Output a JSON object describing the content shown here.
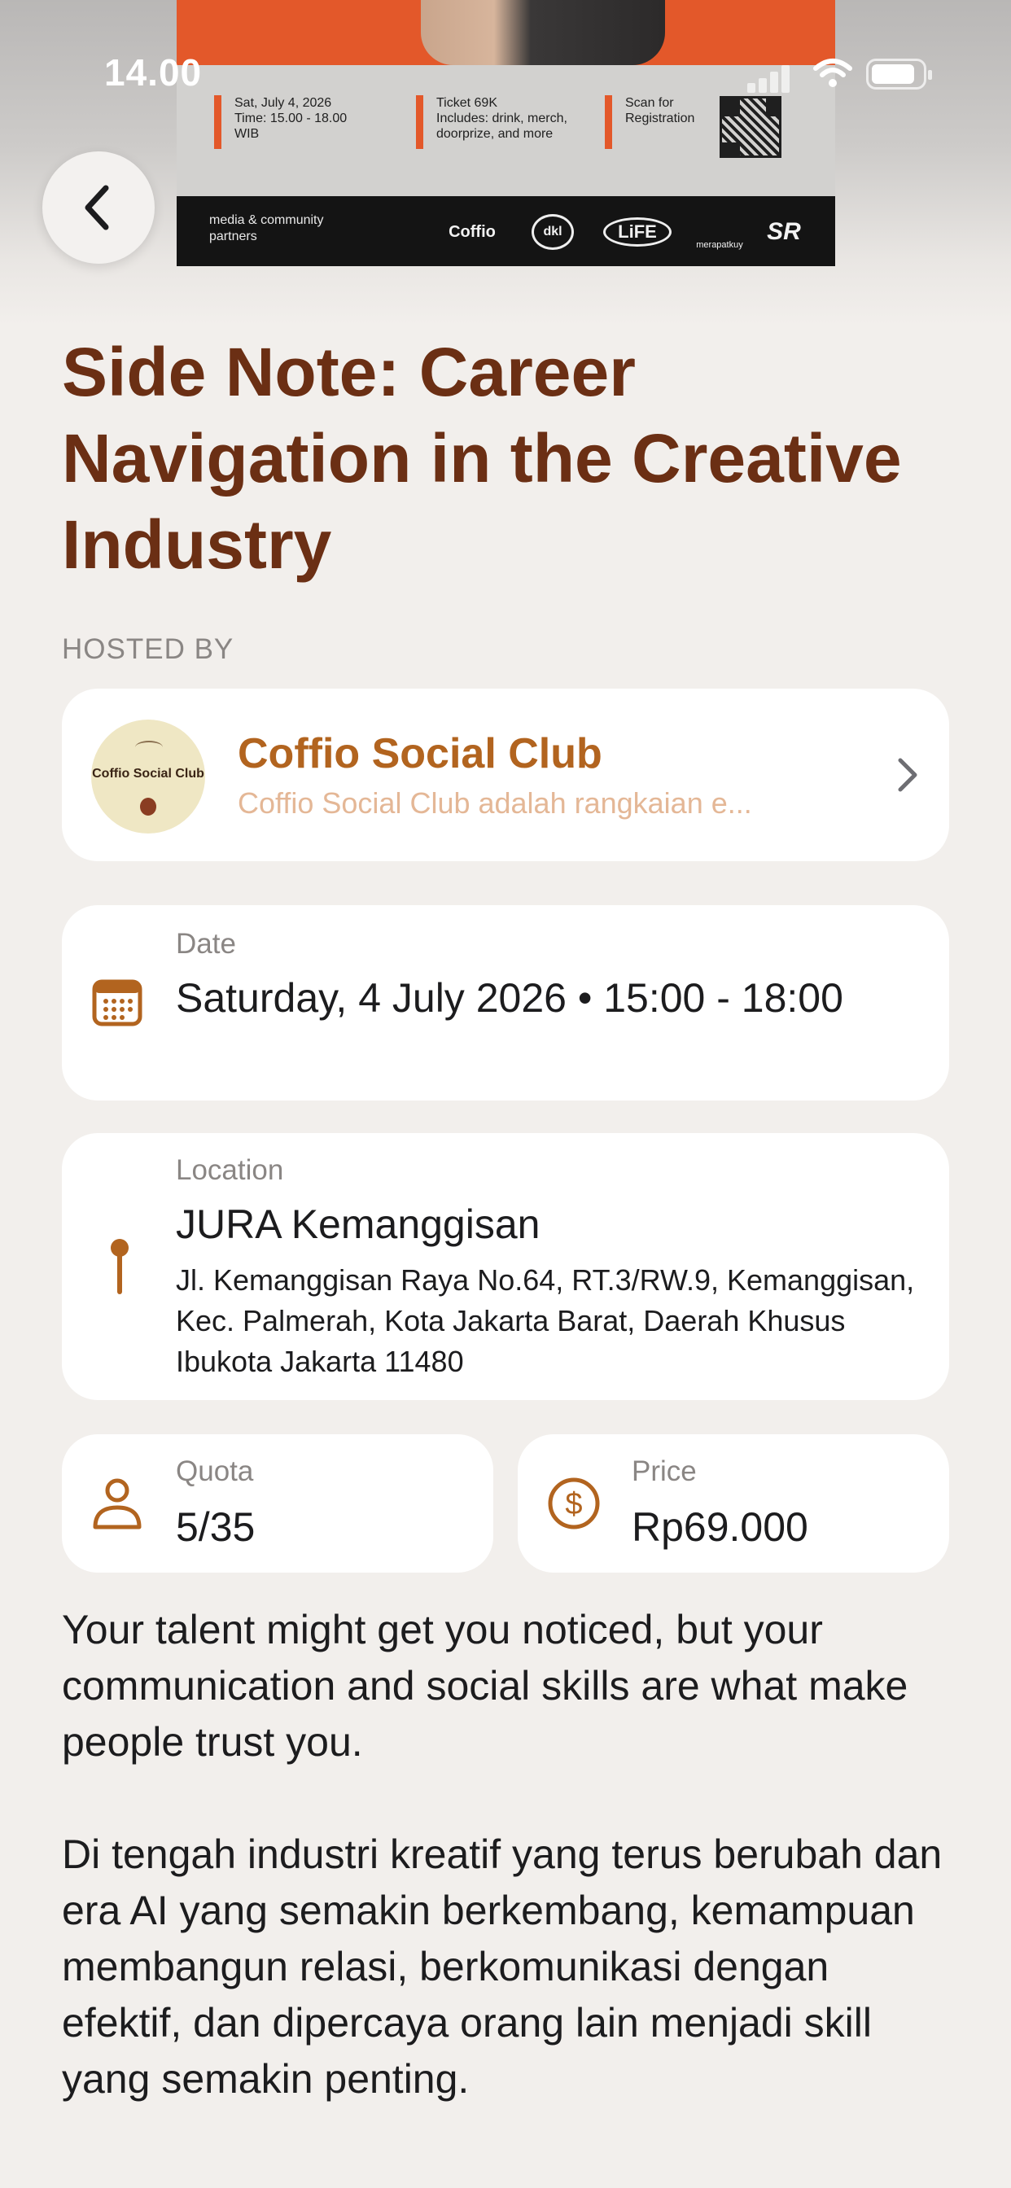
{
  "status_bar": {
    "time": "14.00"
  },
  "poster": {
    "info": [
      {
        "line1": "Sat, July 4, 2026",
        "line2": "Time: 15.00 - 18.00",
        "line3": "WIB"
      },
      {
        "line1": "Ticket 69K",
        "line2": "Includes: drink, merch,",
        "line3": "doorprize, and more"
      },
      {
        "line1": "Scan for",
        "line2": "Registration",
        "line3": ""
      }
    ],
    "partners_label": "media & community partners",
    "partners": [
      "Coffio",
      "dkl",
      "LiFE",
      "merapatkuy",
      "SR"
    ]
  },
  "event": {
    "title": "Side Note: Career Navigation in the Creative Industry"
  },
  "host": {
    "section_label": "HOSTED BY",
    "logo_text": "Coffio Social Club",
    "name": "Coffio Social Club",
    "description": "Coffio Social Club adalah rangkaian e..."
  },
  "date": {
    "label": "Date",
    "value": "Saturday, 4 July 2026 • 15:00 - 18:00",
    "icon": "calendar-icon"
  },
  "location": {
    "label": "Location",
    "name": "JURA Kemanggisan",
    "address": "Jl. Kemanggisan Raya No.64, RT.3/RW.9, Kemanggisan, Kec. Palmerah, Kota Jakarta Barat, Daerah Khusus Ibukota Jakarta 11480",
    "icon": "location-pin-icon"
  },
  "quota": {
    "label": "Quota",
    "value": "5/35",
    "icon": "person-icon"
  },
  "price": {
    "label": "Price",
    "value": "Rp69.000",
    "icon": "dollar-circle-icon"
  },
  "description": {
    "paragraph1": "Your talent might get you noticed, but your communication and social skills are what make people trust you.",
    "paragraph2": "Di tengah industri kreatif yang terus berubah dan era AI yang semakin berkembang, kemampuan membangun relasi, berkomunikasi dengan efektif, dan dipercaya orang lain menjadi skill yang semakin penting."
  },
  "colors": {
    "title": "#6b2f14",
    "accent": "#b2641f",
    "background": "#f2efec",
    "poster_orange": "#e3582a"
  }
}
